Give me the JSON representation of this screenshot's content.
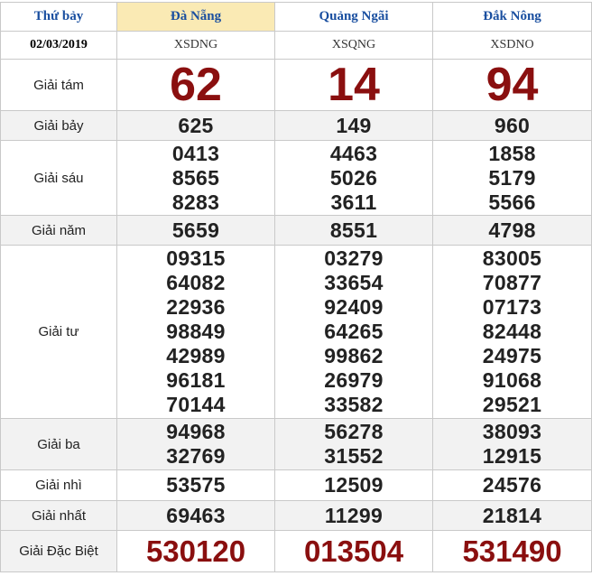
{
  "header": {
    "day": "Thứ bảy",
    "provinces": [
      "Đà Nẵng",
      "Quảng Ngãi",
      "Đắk Nông"
    ]
  },
  "date": "02/03/2019",
  "codes": [
    "XSDNG",
    "XSQNG",
    "XSDNO"
  ],
  "labels": {
    "g8": "Giải tám",
    "g7": "Giải bảy",
    "g6": "Giải sáu",
    "g5": "Giải năm",
    "g4": "Giải tư",
    "g3": "Giải ba",
    "g2": "Giải nhì",
    "g1": "Giải nhất",
    "db": "Giải Đặc Biệt"
  },
  "results": [
    {
      "g8": "62",
      "g7": "625",
      "g6": [
        "0413",
        "8565",
        "8283"
      ],
      "g5": "5659",
      "g4": [
        "09315",
        "64082",
        "22936",
        "98849",
        "42989",
        "96181",
        "70144"
      ],
      "g3": [
        "94968",
        "32769"
      ],
      "g2": "53575",
      "g1": "69463",
      "db": "530120"
    },
    {
      "g8": "14",
      "g7": "149",
      "g6": [
        "4463",
        "5026",
        "3611"
      ],
      "g5": "8551",
      "g4": [
        "03279",
        "33654",
        "92409",
        "64265",
        "99862",
        "26979",
        "33582"
      ],
      "g3": [
        "56278",
        "31552"
      ],
      "g2": "12509",
      "g1": "11299",
      "db": "013504"
    },
    {
      "g8": "94",
      "g7": "960",
      "g6": [
        "1858",
        "5179",
        "5566"
      ],
      "g5": "4798",
      "g4": [
        "83005",
        "70877",
        "07173",
        "82448",
        "24975",
        "91068",
        "29521"
      ],
      "g3": [
        "38093",
        "12915"
      ],
      "g2": "24576",
      "g1": "21814",
      "db": "531490"
    }
  ],
  "colors": {
    "header_text": "#1a4fa0",
    "highlight_bg": "#faeab4",
    "accent_number": "#8a0f0f",
    "alt_row_bg": "#f2f2f2"
  }
}
